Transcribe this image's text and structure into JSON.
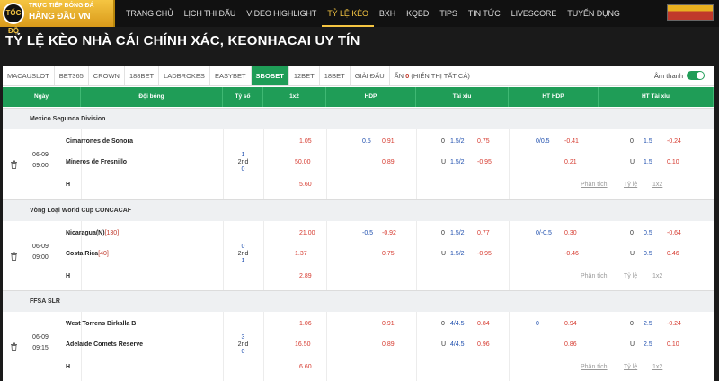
{
  "header": {
    "logo_top": "TRỰC TIẾP BÓNG ĐÁ",
    "logo_main": "HÀNG ĐẦU VN",
    "logo_badge": "TỐC ĐỘ",
    "nav": [
      "TRANG CHỦ",
      "LỊCH THI ĐẤU",
      "VIDEO HIGHLIGHT",
      "TỶ LỆ KÈO",
      "BXH",
      "KQBD",
      "TIPS",
      "TIN TỨC",
      "LIVESCORE",
      "TUYỂN DỤNG"
    ],
    "active_nav": "TỶ LỆ KÈO"
  },
  "page_title": "TỶ LỆ KÈO NHÀ CÁI CHÍNH XÁC, KEONHACAI UY TÍN",
  "tabs": {
    "items": [
      "MACAUSLOT",
      "BET365",
      "CROWN",
      "188BET",
      "LADBROKES",
      "EASYBET",
      "SBOBET",
      "12BET",
      "18BET",
      "GIẢI ĐẤU"
    ],
    "active": "SBOBET",
    "hidden_label": "ẨN",
    "hidden_count": "0",
    "show_all": "(HIỂN THỊ TẤT CẢ)",
    "sound_label": "Âm thanh"
  },
  "columns": [
    "Ngày",
    "Đội bóng",
    "Tỷ số",
    "1x2",
    "HDP",
    "Tài xỉu",
    "HT HDP",
    "HT Tài xỉu"
  ],
  "links": [
    "Phân tích",
    "Tỷ lệ",
    "1x2"
  ],
  "leagues": [
    {
      "name": "Mexico Segunda Division",
      "date": "06-09",
      "time": "09:00",
      "score": [
        "1",
        "2nd",
        "0"
      ],
      "home": {
        "name": "Cimarrones de Sonora",
        "rank": "",
        "x12": "1.05",
        "hdp_line": "0.5",
        "hdp_odd": "0.91",
        "ou_side": "0",
        "ou_line": "1.5/2",
        "ou_odd": "0.75",
        "hthdp_line": "0/0.5",
        "hthdp_odd": "-0.41",
        "htou_side": "0",
        "htou_line": "1.5",
        "htou_odd": "-0.24"
      },
      "away": {
        "name": "Mineros de Fresnillo",
        "rank": "",
        "x12": "50.00",
        "hdp_line": "",
        "hdp_odd": "0.89",
        "ou_side": "U",
        "ou_line": "1.5/2",
        "ou_odd": "-0.95",
        "hthdp_line": "",
        "hthdp_odd": "0.21",
        "htou_side": "U",
        "htou_line": "1.5",
        "htou_odd": "0.10"
      },
      "draw": {
        "label": "H",
        "x12": "5.60"
      }
    },
    {
      "name": "Vòng Loại World Cup CONCACAF",
      "date": "06-09",
      "time": "09:00",
      "score": [
        "0",
        "2nd",
        "1"
      ],
      "home": {
        "name": "Nicaragua(N)",
        "rank": "[130]",
        "x12": "21.00",
        "hdp_line": "-0.5",
        "hdp_odd": "-0.92",
        "ou_side": "0",
        "ou_line": "1.5/2",
        "ou_odd": "0.77",
        "hthdp_line": "0/-0.5",
        "hthdp_odd": "0.30",
        "htou_side": "0",
        "htou_line": "0.5",
        "htou_odd": "-0.64"
      },
      "away": {
        "name": "Costa Rica",
        "rank": "[40]",
        "x12": "1.37",
        "hdp_line": "",
        "hdp_odd": "0.75",
        "ou_side": "U",
        "ou_line": "1.5/2",
        "ou_odd": "-0.95",
        "hthdp_line": "",
        "hthdp_odd": "-0.46",
        "htou_side": "U",
        "htou_line": "0.5",
        "htou_odd": "0.46"
      },
      "draw": {
        "label": "H",
        "x12": "2.89"
      }
    },
    {
      "name": "FFSA SLR",
      "date": "06-09",
      "time": "09:15",
      "score": [
        "3",
        "2nd",
        "0"
      ],
      "home": {
        "name": "West Torrens Birkalla B",
        "rank": "",
        "x12": "1.06",
        "hdp_line": "",
        "hdp_odd": "0.91",
        "ou_side": "0",
        "ou_line": "4/4.5",
        "ou_odd": "0.84",
        "hthdp_line": "0",
        "hthdp_odd": "0.94",
        "htou_side": "0",
        "htou_line": "2.5",
        "htou_odd": "-0.24"
      },
      "away": {
        "name": "Adelaide Comets Reserve",
        "rank": "",
        "x12": "16.50",
        "hdp_line": "",
        "hdp_odd": "0.89",
        "ou_side": "U",
        "ou_line": "4/4.5",
        "ou_odd": "0.96",
        "hthdp_line": "",
        "hthdp_odd": "0.86",
        "htou_side": "U",
        "htou_line": "2.5",
        "htou_odd": "0.10"
      },
      "draw": {
        "label": "H",
        "x12": "6.60"
      }
    }
  ]
}
